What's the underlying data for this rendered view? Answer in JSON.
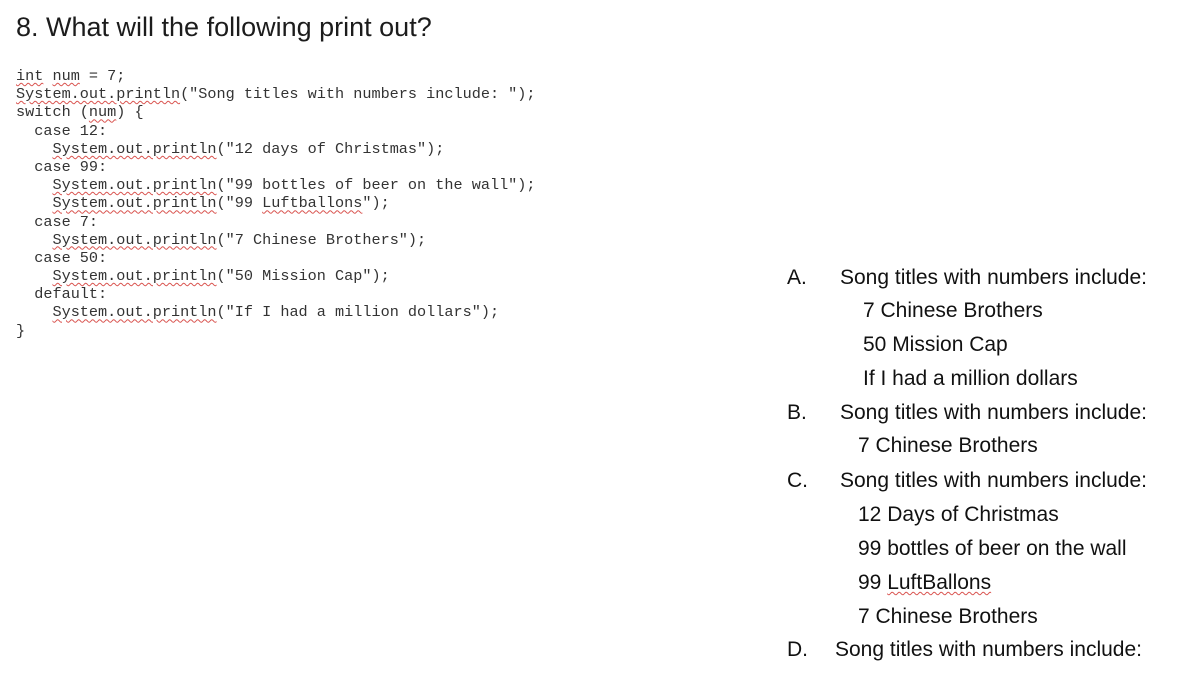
{
  "question": {
    "title": "8.  What will the following print out?"
  },
  "code": {
    "lines": [
      {
        "indent": "",
        "parts": [
          {
            "t": "int",
            "sq": true
          },
          {
            "t": " "
          },
          {
            "t": "num",
            "sq": true
          },
          {
            "t": " = 7;"
          }
        ]
      },
      {
        "indent": "",
        "parts": [
          {
            "t": "System.out.println",
            "sq": true
          },
          {
            "t": "(\"Song titles with numbers include: \");"
          }
        ]
      },
      {
        "indent": "",
        "parts": [
          {
            "t": "switch ("
          },
          {
            "t": "num",
            "sq": true
          },
          {
            "t": ") {"
          }
        ]
      },
      {
        "indent": "  ",
        "parts": [
          {
            "t": "case 12:"
          }
        ]
      },
      {
        "indent": "    ",
        "parts": [
          {
            "t": "System.out.println",
            "sq": true
          },
          {
            "t": "(\"12 days of Christmas\");"
          }
        ]
      },
      {
        "indent": "  ",
        "parts": [
          {
            "t": "case 99:"
          }
        ]
      },
      {
        "indent": "    ",
        "parts": [
          {
            "t": "System.out.println",
            "sq": true
          },
          {
            "t": "(\"99 bottles of beer on the wall\");"
          }
        ]
      },
      {
        "indent": "    ",
        "parts": [
          {
            "t": "System.out.println",
            "sq": true
          },
          {
            "t": "(\"99 "
          },
          {
            "t": "Luftballons",
            "sq": true
          },
          {
            "t": "\");"
          }
        ]
      },
      {
        "indent": "  ",
        "parts": [
          {
            "t": "case 7:"
          }
        ]
      },
      {
        "indent": "    ",
        "parts": [
          {
            "t": "System.out.println",
            "sq": true
          },
          {
            "t": "(\"7 Chinese Brothers\");"
          }
        ]
      },
      {
        "indent": "  ",
        "parts": [
          {
            "t": "case 50:"
          }
        ]
      },
      {
        "indent": "    ",
        "parts": [
          {
            "t": "System.out.println",
            "sq": true
          },
          {
            "t": "(\"50 Mission Cap\");"
          }
        ]
      },
      {
        "indent": "  ",
        "parts": [
          {
            "t": "default:"
          }
        ]
      },
      {
        "indent": "    ",
        "parts": [
          {
            "t": "System.out.println",
            "sq": true
          },
          {
            "t": "(\"If I had a million dollars\");"
          }
        ]
      },
      {
        "indent": "",
        "parts": [
          {
            "t": "}"
          }
        ]
      }
    ]
  },
  "answers": [
    {
      "letter": "A.",
      "header": "Song titles with numbers include:",
      "lines": [
        "7 Chinese Brothers",
        "50 Mission Cap",
        "If I had a million dollars"
      ]
    },
    {
      "letter": "B.",
      "header": "Song titles with numbers include:",
      "lines": [
        "7 Chinese Brothers"
      ]
    },
    {
      "letter": "C.",
      "header": "Song titles with numbers include:",
      "lines": [
        "12 Days of Christmas",
        "99 bottles of beer on the wall",
        "99 LuftBallons",
        "7 Chinese Brothers"
      ]
    },
    {
      "letter": "D.",
      "header": "Song titles with numbers include:",
      "lines": []
    }
  ]
}
